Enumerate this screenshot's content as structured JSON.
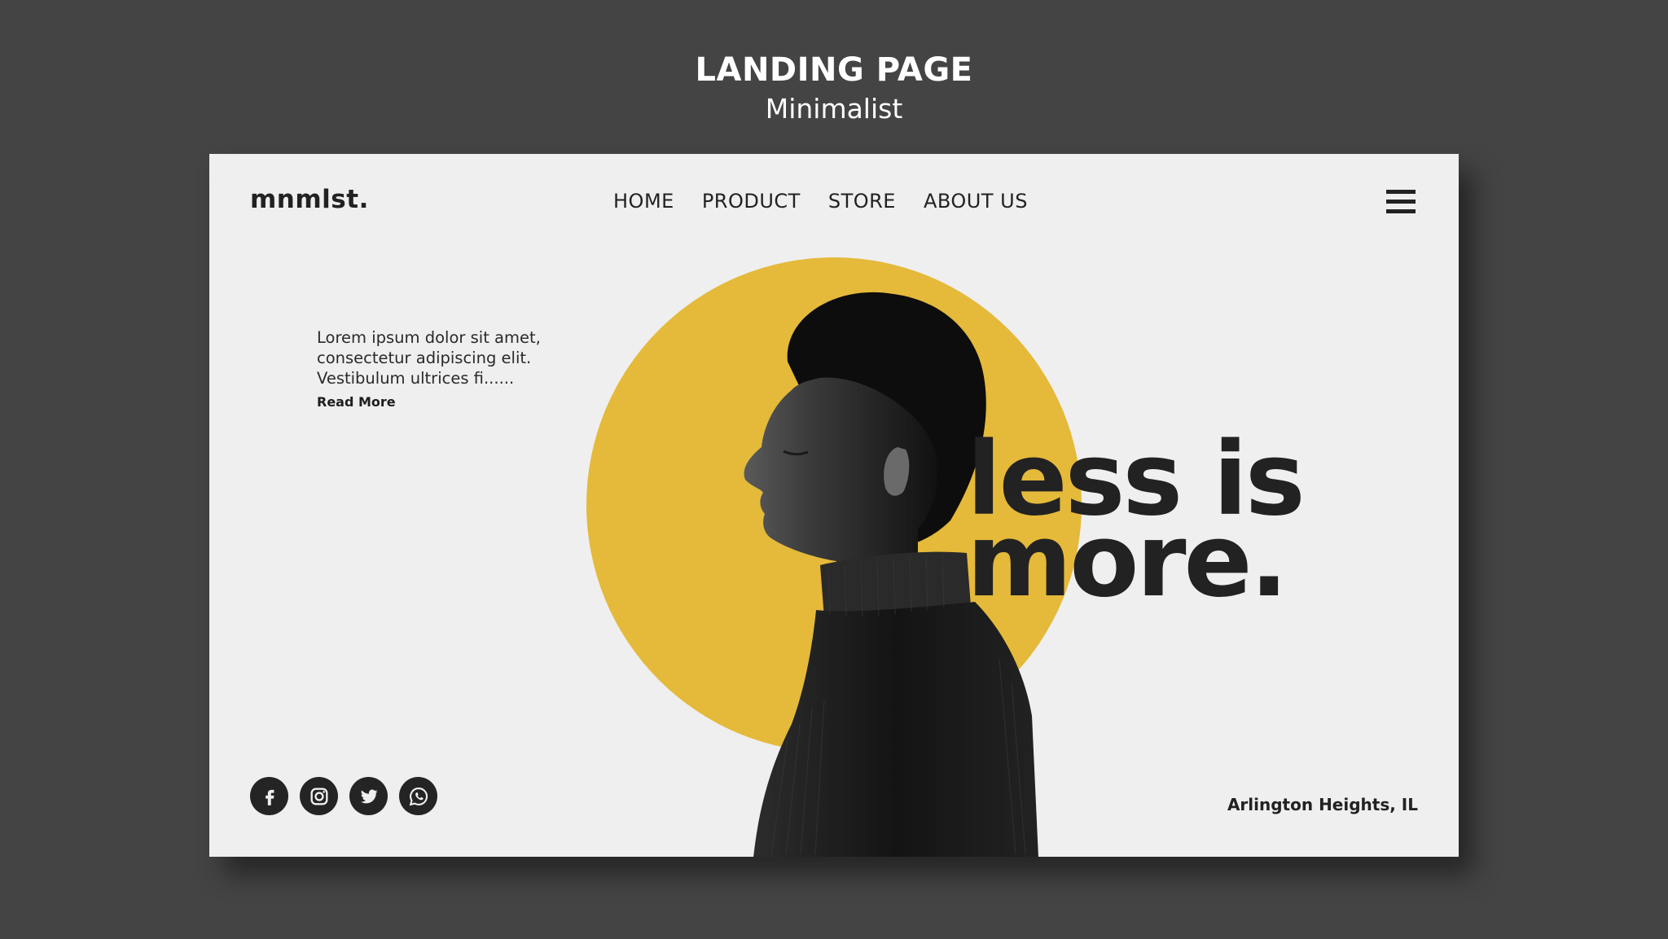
{
  "presentation": {
    "title": "LANDING PAGE",
    "subtitle": "Minimalist"
  },
  "header": {
    "logo": "mnmlst.",
    "nav": [
      {
        "label": "HOME"
      },
      {
        "label": "PRODUCT"
      },
      {
        "label": "STORE"
      },
      {
        "label": "ABOUT US"
      }
    ],
    "menu_icon": "hamburger-menu-icon"
  },
  "hero": {
    "intro_lines": [
      "Lorem ipsum dolor sit amet,",
      "consectetur adipiscing elit.",
      "Vestibulum ultrices fi......"
    ],
    "read_more": "Read More",
    "headline_lines": [
      "less is",
      "more."
    ],
    "image": "profile-portrait-person-turtleneck"
  },
  "footer": {
    "social": [
      {
        "name": "facebook-icon"
      },
      {
        "name": "instagram-icon"
      },
      {
        "name": "twitter-icon"
      },
      {
        "name": "whatsapp-icon"
      }
    ],
    "location": "Arlington Heights, IL"
  },
  "colors": {
    "background": "#444444",
    "card": "#efefef",
    "accent_yellow": "#e5b93a",
    "text_dark": "#222222"
  }
}
